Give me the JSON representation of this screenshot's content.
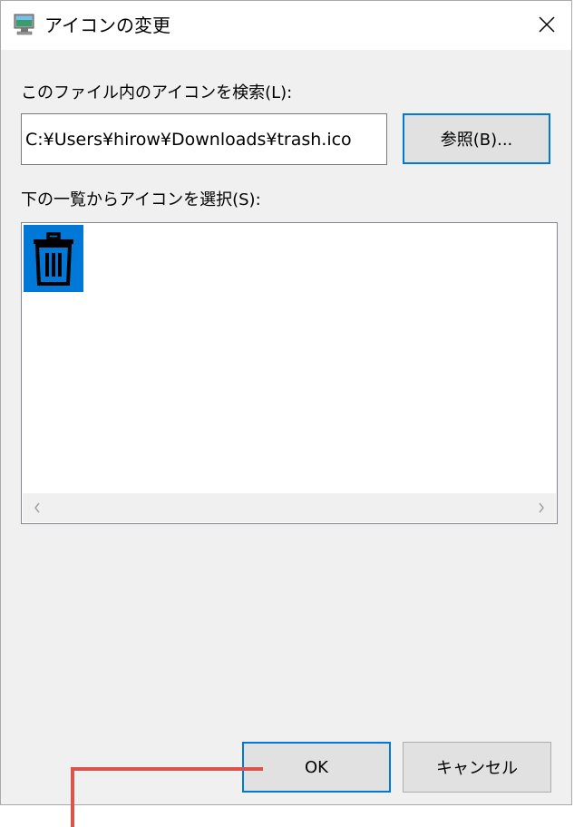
{
  "window": {
    "title": "アイコンの変更",
    "close_glyph": "✕",
    "app_icon": "monitor-icon"
  },
  "file_section": {
    "label": "このファイル内のアイコンを検索(L):",
    "path_value": "C:¥Users¥hirow¥Downloads¥trash.ico",
    "browse_label": "参照(B)..."
  },
  "icon_section": {
    "label": "下の一覧からアイコンを選択(S):",
    "icons": [
      {
        "name": "trash-can-icon",
        "selected": true
      }
    ],
    "scroll_left_glyph": "‹",
    "scroll_right_glyph": "›"
  },
  "footer": {
    "ok_label": "OK",
    "cancel_label": "キャンセル"
  },
  "colors": {
    "selection": "#0078d7",
    "annotation": "#d9534f",
    "dialog_bg": "#f0f0f0"
  }
}
